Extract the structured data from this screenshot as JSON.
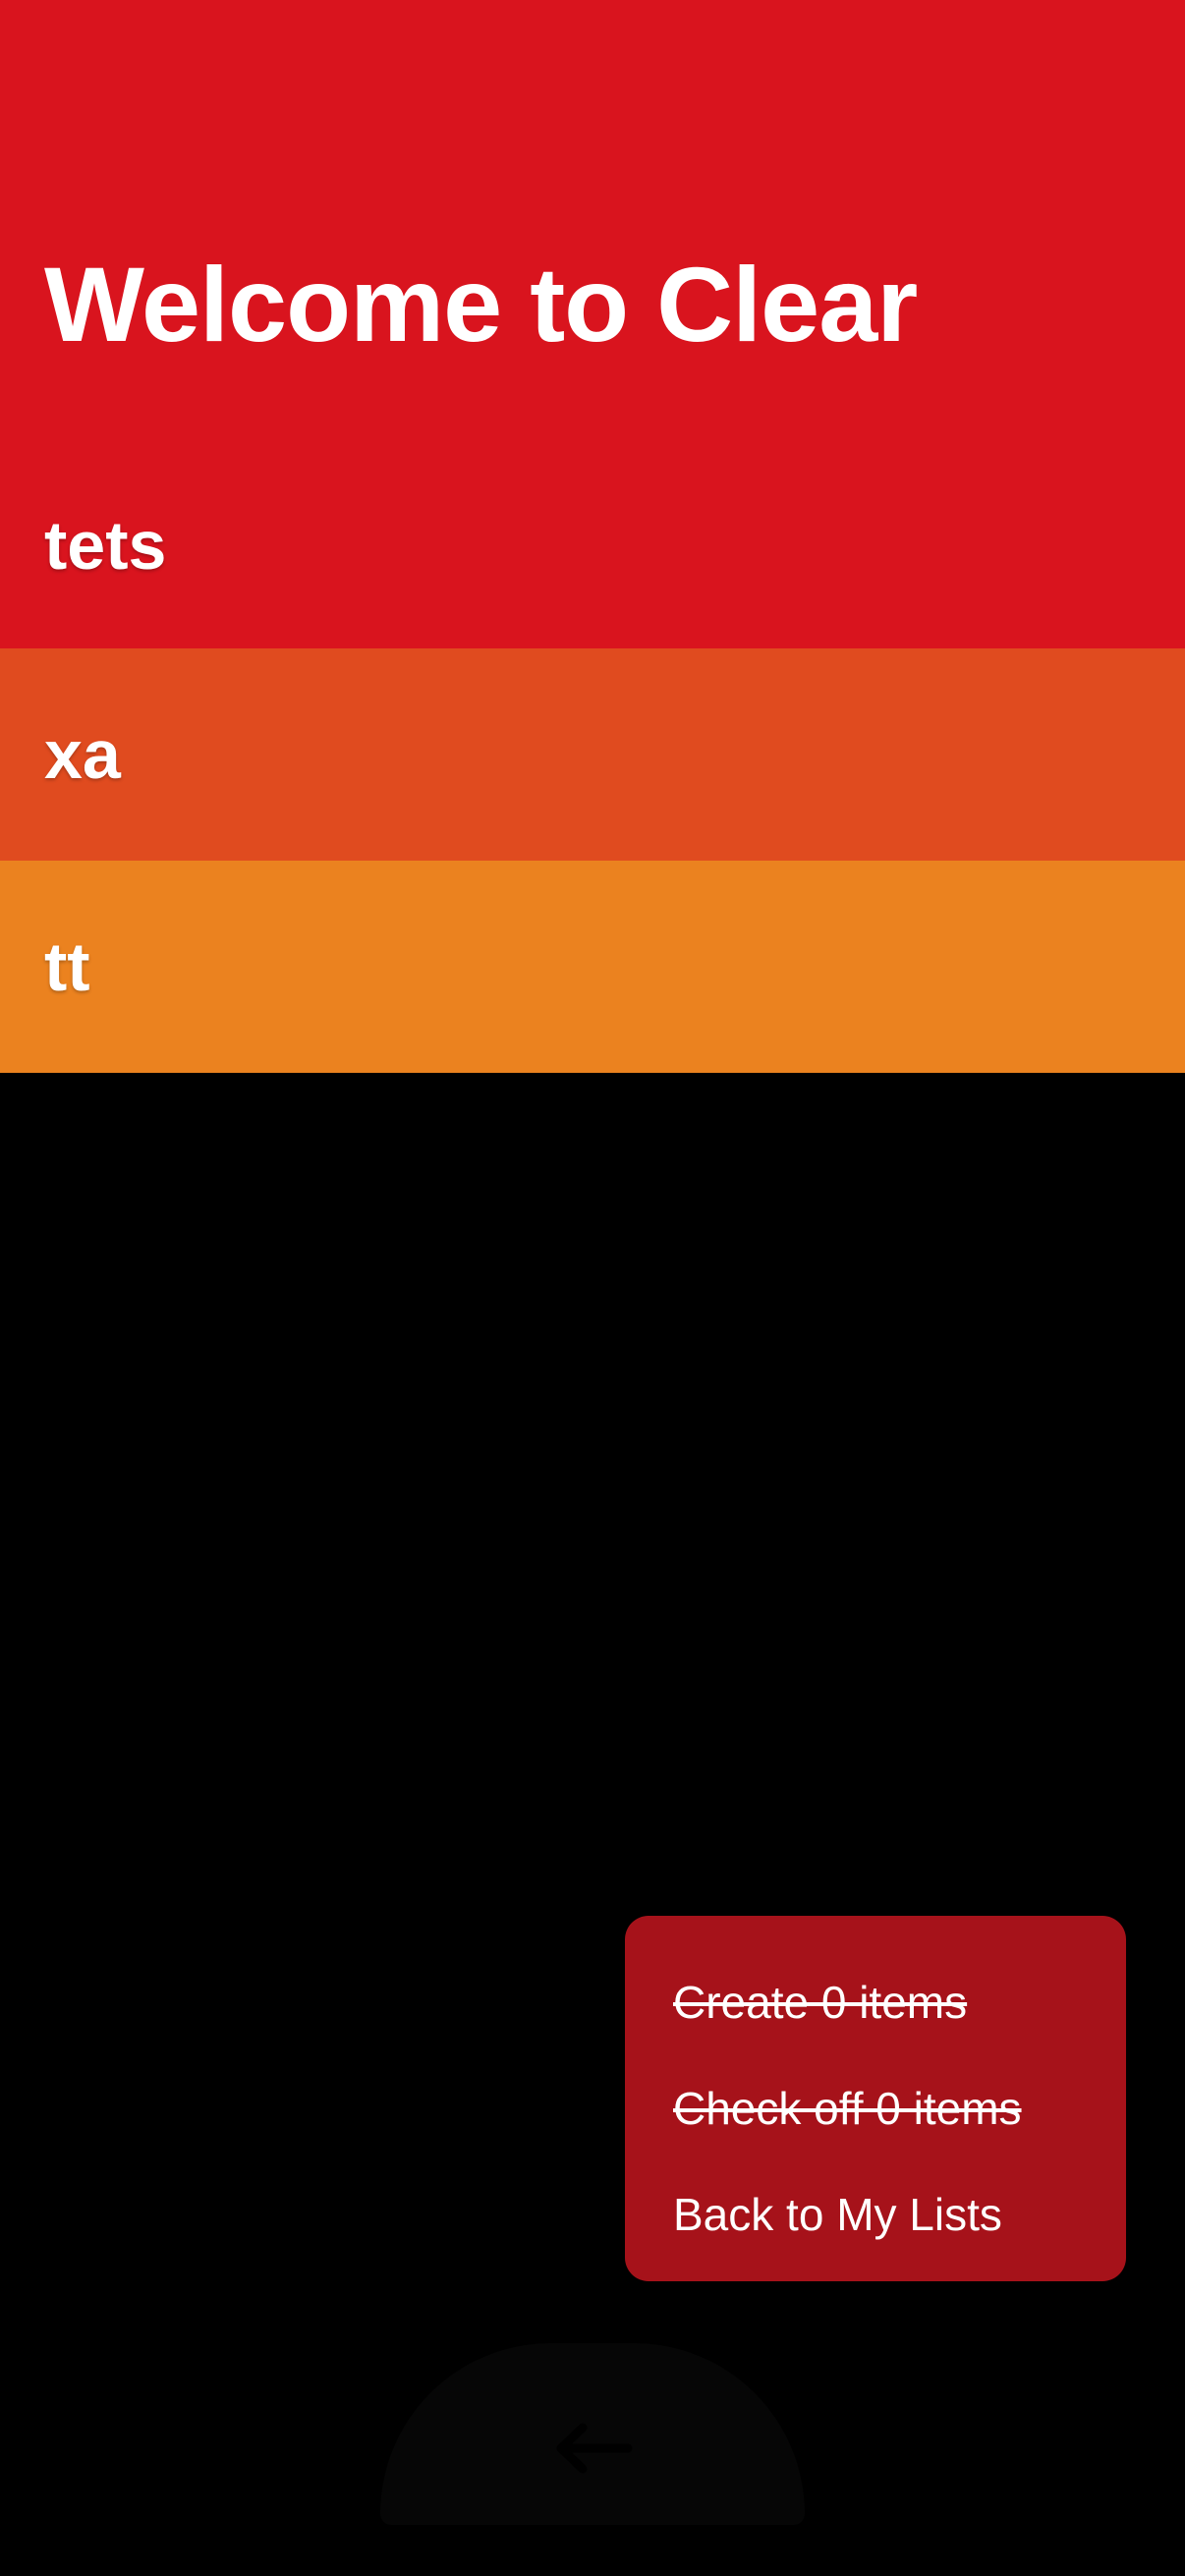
{
  "header": {
    "title": "Welcome to Clear",
    "background": "#d9141e"
  },
  "items": [
    {
      "label": "tets",
      "color": "#d9141e"
    },
    {
      "label": "xa",
      "color": "#e04b1f"
    },
    {
      "label": "tt",
      "color": "#eb821f"
    }
  ],
  "menu": {
    "background": "#a6121a",
    "create_label": "Create 0 items",
    "check_off_label": "Check off 0 items",
    "back_label": "Back to My Lists"
  },
  "footer": {
    "back_icon": "arrow-left-icon"
  }
}
